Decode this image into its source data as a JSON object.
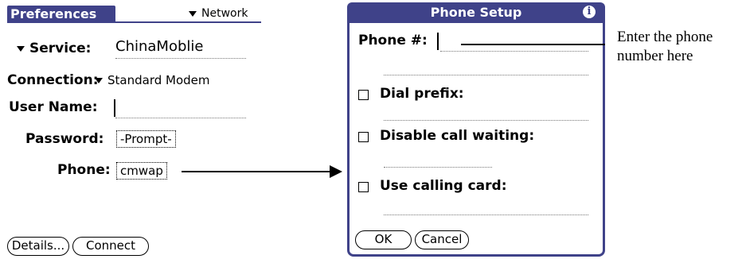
{
  "preferences": {
    "title": "Preferences",
    "panel_picker": "Network",
    "service_label": "Service:",
    "service_value": "ChinaMoblie",
    "connection_label": "Connection:",
    "connection_value": "Standard Modem",
    "username_label": "User Name:",
    "username_value": "",
    "password_label": "Password:",
    "password_value": "-Prompt-",
    "phone_label": "Phone:",
    "phone_value": "cmwap",
    "details_button": "Details...",
    "connect_button": "Connect"
  },
  "phone_setup": {
    "title": "Phone Setup",
    "info_icon": "i",
    "phone_label": "Phone #:",
    "phone_value": "",
    "dial_prefix_label": "Dial prefix:",
    "disable_call_waiting_label": "Disable call waiting:",
    "calling_card_label": "Use calling card:",
    "ok_button": "OK",
    "cancel_button": "Cancel"
  },
  "annotation": {
    "line1": "Enter the phone",
    "line2": "number here"
  },
  "colors": {
    "titlebar": "#3f4289"
  }
}
